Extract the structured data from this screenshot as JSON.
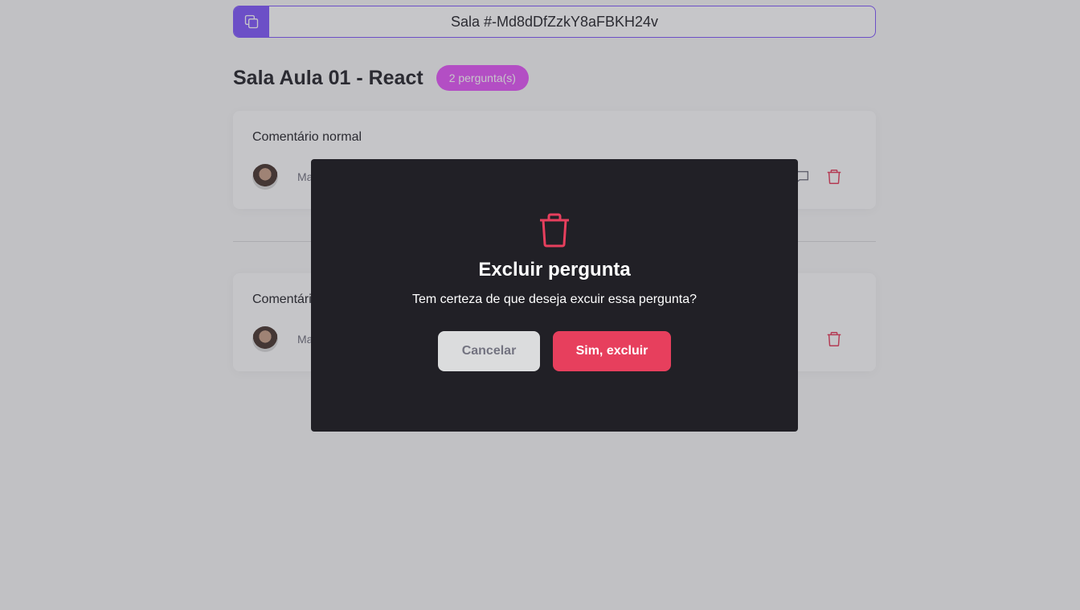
{
  "header": {
    "room_code_label": "Sala #-Md8dDfZzkY8aFBKH24v",
    "copy_icon": "copy-icon"
  },
  "room": {
    "title": "Sala Aula 01 - React",
    "question_count_badge": "2 pergunta(s)"
  },
  "questions": [
    {
      "content": "Comentário normal",
      "author": "Ma",
      "actions": [
        "answer-icon",
        "trash-icon"
      ]
    },
    {
      "content": "Comentári",
      "author": "Ma",
      "actions": [
        "trash-icon"
      ]
    }
  ],
  "modal": {
    "icon": "trash-icon",
    "title": "Excluir pergunta",
    "message": "Tem certeza de que deseja excuir essa pergunta?",
    "cancel_label": "Cancelar",
    "confirm_label": "Sim, excluir"
  },
  "colors": {
    "brand_purple": "#835afd",
    "badge_pink": "#e559f9",
    "danger": "#e73f5d",
    "modal_bg": "#212026",
    "overlay": "rgba(50,50,60,0.28)"
  }
}
